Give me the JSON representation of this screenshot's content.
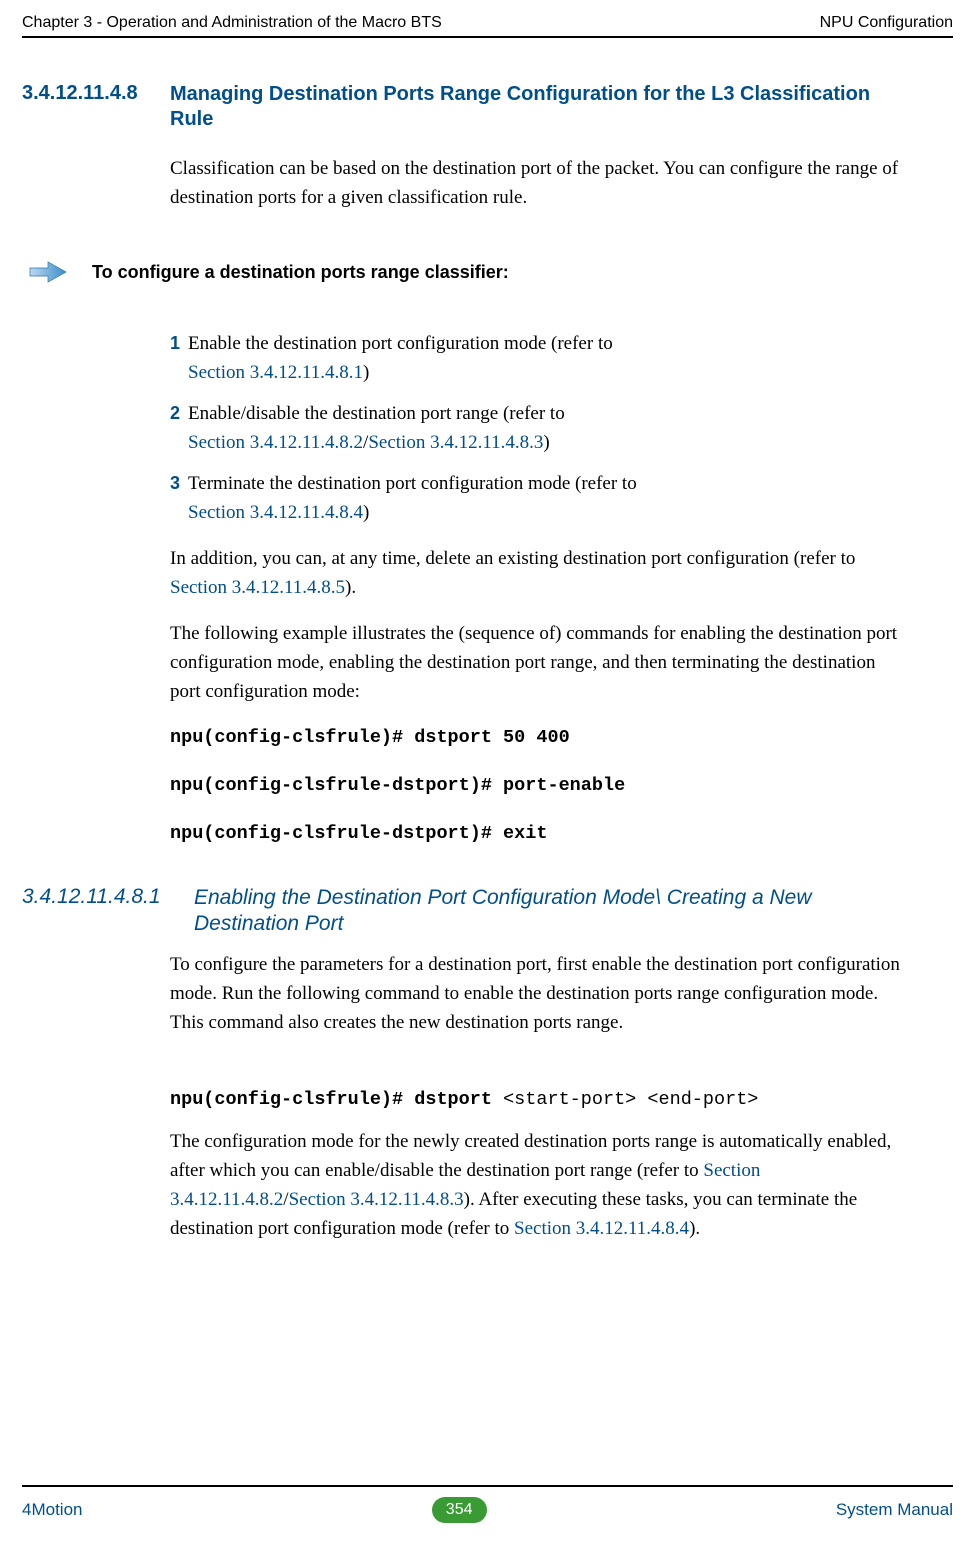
{
  "header": {
    "left": "Chapter 3 - Operation and Administration of the Macro BTS",
    "right": "NPU Configuration"
  },
  "sec1": {
    "num": "3.4.12.11.4.8",
    "title": "Managing Destination Ports Range Configuration for the L3 Classification Rule",
    "intro": "Classification can be based on the destination port of the packet. You can configure the range of destination ports for a given classification rule.",
    "to_configure": "To configure a destination ports range classifier:",
    "steps": [
      {
        "n": "1",
        "text": "Enable the destination port configuration mode (refer to ",
        "link1": "Section 3.4.12.11.4.8.1",
        "after1": ")"
      },
      {
        "n": "2",
        "text": "Enable/disable the destination port range (refer to ",
        "link1": "Section 3.4.12.11.4.8.2",
        "sep": "/",
        "link2": "Section 3.4.12.11.4.8.3",
        "after": ")"
      },
      {
        "n": "3",
        "text": "Terminate the destination port configuration mode (refer to ",
        "link1": "Section 3.4.12.11.4.8.4",
        "after1": ")"
      }
    ],
    "addition_a": "In addition, you can, at any time, delete an existing destination port configuration (refer to ",
    "addition_link": "Section 3.4.12.11.4.8.5",
    "addition_b": ").",
    "example": "The following example illustrates the (sequence of) commands for enabling the destination port configuration mode, enabling the destination port range, and then terminating the destination port configuration mode:",
    "cmd1": "npu(config-clsfrule)# dstport 50 400",
    "cmd2": "npu(config-clsfrule-dstport)# port-enable",
    "cmd3": "npu(config-clsfrule-dstport)# exit"
  },
  "sec2": {
    "num": "3.4.12.11.4.8.1",
    "title": "Enabling the Destination Port Configuration Mode\\ Creating a New Destination Port",
    "p1": "To configure the parameters for a destination port, first enable the destination port configuration mode. Run the following command to enable the destination ports range configuration mode. This command also creates the new destination ports range.",
    "cmd_a": "npu(config-clsfrule)# dstport ",
    "cmd_b": "<start-port> <end-port>",
    "p2a": "The configuration mode for the newly created destination ports range is automatically enabled, after which you can enable/disable the destination port range (refer to ",
    "p2_link1": "Section 3.4.12.11.4.8.2",
    "p2_sep": "/",
    "p2_link2": "Section 3.4.12.11.4.8.3",
    "p2b": "). After executing these tasks, you can terminate the destination port configuration mode (refer to ",
    "p2_link3": "Section 3.4.12.11.4.8.4",
    "p2c": ")."
  },
  "footer": {
    "left": "4Motion",
    "page": "354",
    "right": "System Manual"
  }
}
